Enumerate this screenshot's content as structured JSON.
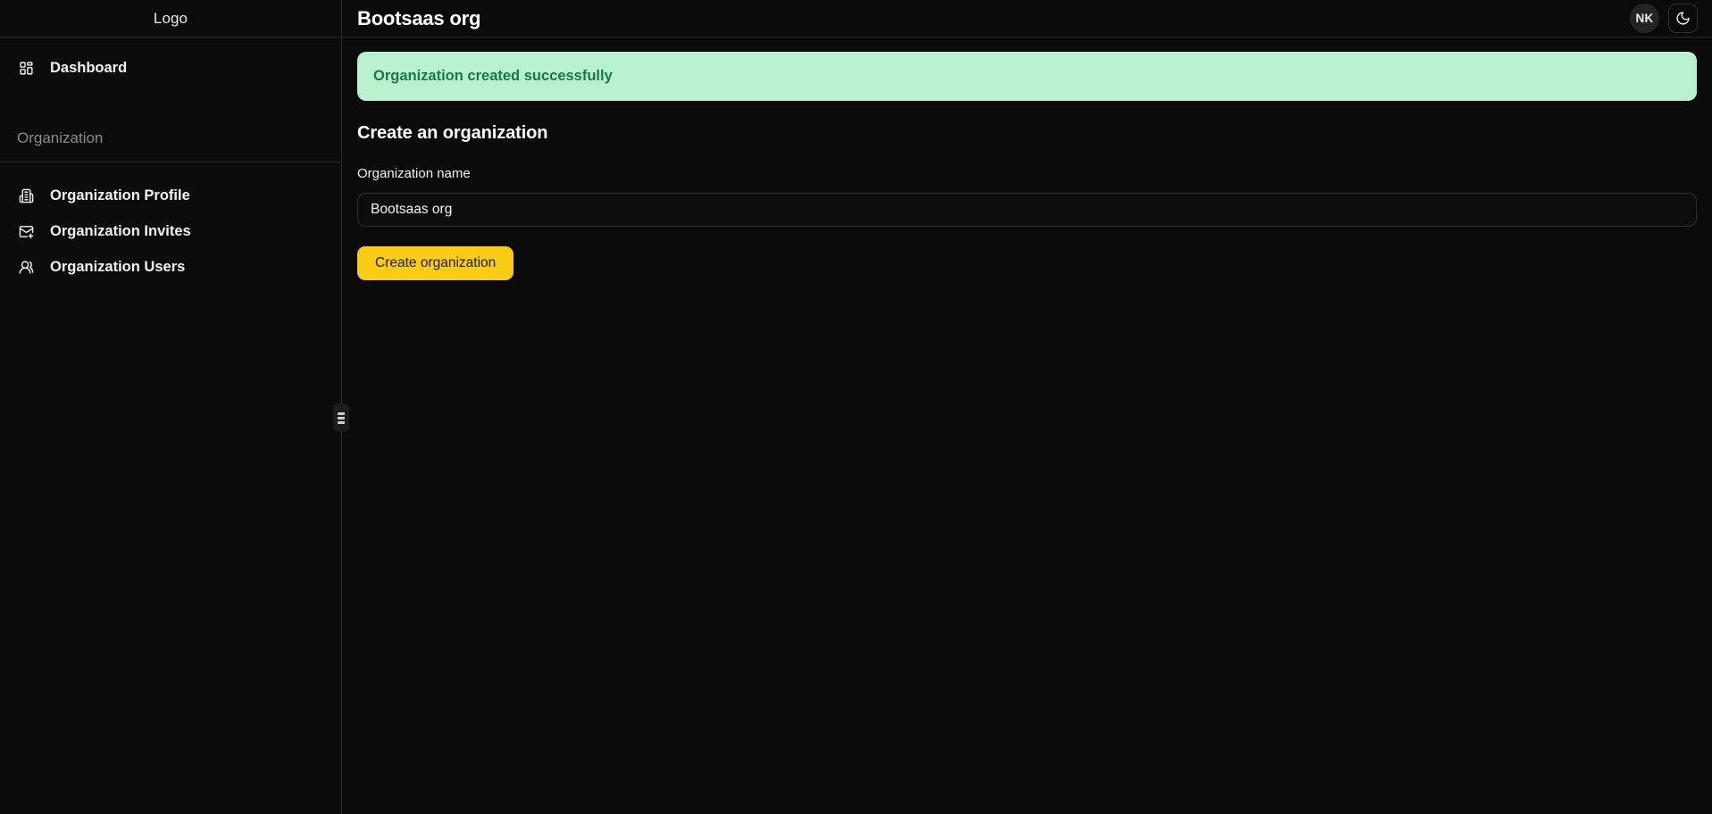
{
  "sidebar": {
    "logo": "Logo",
    "primary_items": [
      {
        "label": "Dashboard",
        "icon": "layout-dashboard-icon"
      }
    ],
    "section": {
      "title": "Organization",
      "items": [
        {
          "label": "Organization Profile",
          "icon": "building-icon"
        },
        {
          "label": "Organization Invites",
          "icon": "mail-plus-icon"
        },
        {
          "label": "Organization Users",
          "icon": "users-icon"
        }
      ]
    },
    "resize_handle": "sidebar-resize-handle"
  },
  "topbar": {
    "title": "Bootsaas org",
    "avatar_initials": "NK",
    "theme_toggle_icon": "moon-icon"
  },
  "content": {
    "alert": {
      "message": "Organization created successfully",
      "bg_color": "#b9f0cd",
      "text_color": "#18794e"
    },
    "form": {
      "heading": "Create an organization",
      "name_label": "Organization name",
      "name_value": "Bootsaas org",
      "name_placeholder": "Organization name",
      "submit_label": "Create organization",
      "submit_color": "#facc15"
    }
  }
}
